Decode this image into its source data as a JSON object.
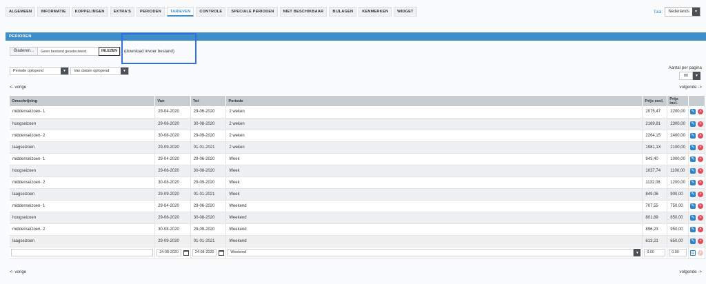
{
  "tabs": [
    "ALGEMEEN",
    "INFORMATIE",
    "KOPPELINGEN",
    "EXTRA'S",
    "PERIODEN",
    "TARIEVEN",
    "CONTROLE",
    "SPECIALE PERIODEN",
    "NIET BESCHIKBAAR",
    "BIJLAGEN",
    "KENMERKEN",
    "WIDGET"
  ],
  "active_tab": "TARIEVEN",
  "language": {
    "label": "Taal:",
    "value": "Nederlands"
  },
  "section_title": "PERIODEN",
  "upload": {
    "browse_label": "Bladeren...",
    "no_file_text": "Geen bestand geselecteerd.",
    "read_button": "INLEZEN",
    "download_link": "(download invoer bestand)"
  },
  "sort": {
    "period_order": "Periode oplopend",
    "date_order": "Van datum oplopend"
  },
  "per_page": {
    "label": "Aantal per pagina",
    "value": "80"
  },
  "pager": {
    "prev": "<- vorige",
    "next": "volgende ->"
  },
  "table": {
    "headers": [
      "Omschrijving",
      "Van",
      "Tot",
      "Periode",
      "Prijs excl.",
      "Prijs incl."
    ],
    "rows": [
      [
        "middenseizoen- 1",
        "29-04-2020",
        "29-06-2020",
        "2 weken",
        "2075,47",
        "2200,00"
      ],
      [
        "hoogseizoen",
        "29-06-2020",
        "30-08-2020",
        "2 weken",
        "2169,81",
        "2300,00"
      ],
      [
        "middenseizoen- 2",
        "30-08-2020",
        "29-09-2020",
        "2 weken",
        "2264,15",
        "2400,00"
      ],
      [
        "laagseizoen",
        "29-09-2020",
        "01-01-2021",
        "2 weken",
        "1981,13",
        "2100,00"
      ],
      [
        "middenseizoen- 1",
        "29-04-2020",
        "29-06-2020",
        "Week",
        "943,40",
        "1000,00"
      ],
      [
        "hoogseizoen",
        "29-06-2020",
        "30-08-2020",
        "Week",
        "1037,74",
        "1100,00"
      ],
      [
        "middenseizoen- 2",
        "30-08-2020",
        "29-09-2020",
        "Week",
        "1132,08",
        "1200,00"
      ],
      [
        "laagseizoen",
        "29-09-2020",
        "01-01-2021",
        "Week",
        "849,06",
        "900,00"
      ],
      [
        "middenseizoen- 1",
        "29-04-2020",
        "29-06-2020",
        "Weekend",
        "707,55",
        "750,00"
      ],
      [
        "hoogseizoen",
        "29-06-2020",
        "30-08-2020",
        "Weekend",
        "801,89",
        "850,00"
      ],
      [
        "middenseizoen- 2",
        "30-08-2020",
        "29-09-2020",
        "Weekend",
        "896,23",
        "950,00"
      ],
      [
        "laagseizoen",
        "29-09-2020",
        "01-01-2021",
        "Weekend",
        "613,21",
        "650,00"
      ]
    ],
    "new_row": {
      "description": "",
      "from": "24-08-2020",
      "to": "24-08-2020",
      "period": "Weekend",
      "price_excl": "0.00",
      "price_incl": "0.00"
    }
  },
  "colors": {
    "accent": "#3d8ec9",
    "highlight": "#2f6fe0",
    "delete": "#e24b5b",
    "edit": "#2f84c9"
  },
  "icons": {
    "edit": "pencil-icon",
    "delete": "close-circle-icon",
    "calendar": "calendar-icon",
    "save": "save-icon",
    "dropdown": "chevron-down-icon"
  }
}
